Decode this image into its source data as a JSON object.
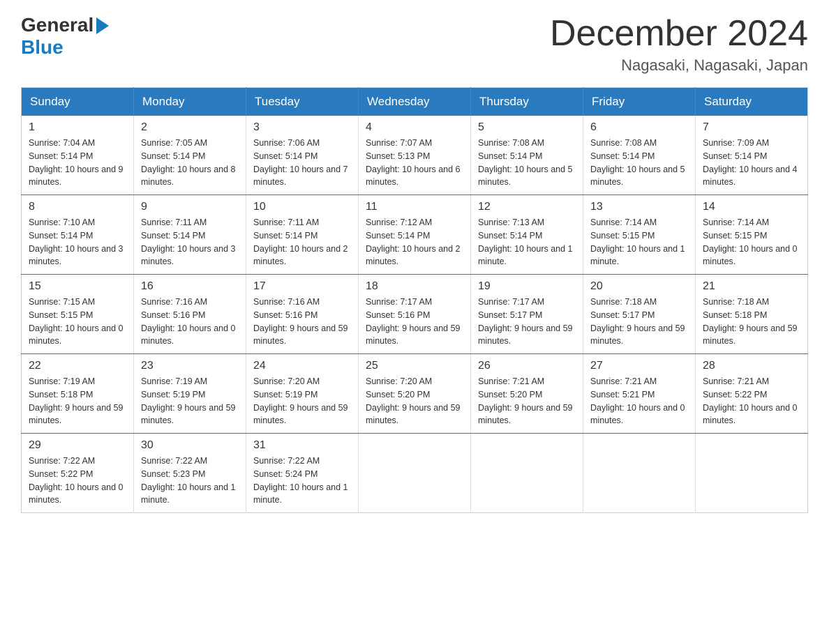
{
  "header": {
    "logo_general": "General",
    "logo_blue": "Blue",
    "title": "December 2024",
    "location": "Nagasaki, Nagasaki, Japan"
  },
  "days_of_week": [
    "Sunday",
    "Monday",
    "Tuesday",
    "Wednesday",
    "Thursday",
    "Friday",
    "Saturday"
  ],
  "weeks": [
    [
      {
        "day": "1",
        "sunrise": "7:04 AM",
        "sunset": "5:14 PM",
        "daylight": "10 hours and 9 minutes."
      },
      {
        "day": "2",
        "sunrise": "7:05 AM",
        "sunset": "5:14 PM",
        "daylight": "10 hours and 8 minutes."
      },
      {
        "day": "3",
        "sunrise": "7:06 AM",
        "sunset": "5:14 PM",
        "daylight": "10 hours and 7 minutes."
      },
      {
        "day": "4",
        "sunrise": "7:07 AM",
        "sunset": "5:13 PM",
        "daylight": "10 hours and 6 minutes."
      },
      {
        "day": "5",
        "sunrise": "7:08 AM",
        "sunset": "5:14 PM",
        "daylight": "10 hours and 5 minutes."
      },
      {
        "day": "6",
        "sunrise": "7:08 AM",
        "sunset": "5:14 PM",
        "daylight": "10 hours and 5 minutes."
      },
      {
        "day": "7",
        "sunrise": "7:09 AM",
        "sunset": "5:14 PM",
        "daylight": "10 hours and 4 minutes."
      }
    ],
    [
      {
        "day": "8",
        "sunrise": "7:10 AM",
        "sunset": "5:14 PM",
        "daylight": "10 hours and 3 minutes."
      },
      {
        "day": "9",
        "sunrise": "7:11 AM",
        "sunset": "5:14 PM",
        "daylight": "10 hours and 3 minutes."
      },
      {
        "day": "10",
        "sunrise": "7:11 AM",
        "sunset": "5:14 PM",
        "daylight": "10 hours and 2 minutes."
      },
      {
        "day": "11",
        "sunrise": "7:12 AM",
        "sunset": "5:14 PM",
        "daylight": "10 hours and 2 minutes."
      },
      {
        "day": "12",
        "sunrise": "7:13 AM",
        "sunset": "5:14 PM",
        "daylight": "10 hours and 1 minute."
      },
      {
        "day": "13",
        "sunrise": "7:14 AM",
        "sunset": "5:15 PM",
        "daylight": "10 hours and 1 minute."
      },
      {
        "day": "14",
        "sunrise": "7:14 AM",
        "sunset": "5:15 PM",
        "daylight": "10 hours and 0 minutes."
      }
    ],
    [
      {
        "day": "15",
        "sunrise": "7:15 AM",
        "sunset": "5:15 PM",
        "daylight": "10 hours and 0 minutes."
      },
      {
        "day": "16",
        "sunrise": "7:16 AM",
        "sunset": "5:16 PM",
        "daylight": "10 hours and 0 minutes."
      },
      {
        "day": "17",
        "sunrise": "7:16 AM",
        "sunset": "5:16 PM",
        "daylight": "9 hours and 59 minutes."
      },
      {
        "day": "18",
        "sunrise": "7:17 AM",
        "sunset": "5:16 PM",
        "daylight": "9 hours and 59 minutes."
      },
      {
        "day": "19",
        "sunrise": "7:17 AM",
        "sunset": "5:17 PM",
        "daylight": "9 hours and 59 minutes."
      },
      {
        "day": "20",
        "sunrise": "7:18 AM",
        "sunset": "5:17 PM",
        "daylight": "9 hours and 59 minutes."
      },
      {
        "day": "21",
        "sunrise": "7:18 AM",
        "sunset": "5:18 PM",
        "daylight": "9 hours and 59 minutes."
      }
    ],
    [
      {
        "day": "22",
        "sunrise": "7:19 AM",
        "sunset": "5:18 PM",
        "daylight": "9 hours and 59 minutes."
      },
      {
        "day": "23",
        "sunrise": "7:19 AM",
        "sunset": "5:19 PM",
        "daylight": "9 hours and 59 minutes."
      },
      {
        "day": "24",
        "sunrise": "7:20 AM",
        "sunset": "5:19 PM",
        "daylight": "9 hours and 59 minutes."
      },
      {
        "day": "25",
        "sunrise": "7:20 AM",
        "sunset": "5:20 PM",
        "daylight": "9 hours and 59 minutes."
      },
      {
        "day": "26",
        "sunrise": "7:21 AM",
        "sunset": "5:20 PM",
        "daylight": "9 hours and 59 minutes."
      },
      {
        "day": "27",
        "sunrise": "7:21 AM",
        "sunset": "5:21 PM",
        "daylight": "10 hours and 0 minutes."
      },
      {
        "day": "28",
        "sunrise": "7:21 AM",
        "sunset": "5:22 PM",
        "daylight": "10 hours and 0 minutes."
      }
    ],
    [
      {
        "day": "29",
        "sunrise": "7:22 AM",
        "sunset": "5:22 PM",
        "daylight": "10 hours and 0 minutes."
      },
      {
        "day": "30",
        "sunrise": "7:22 AM",
        "sunset": "5:23 PM",
        "daylight": "10 hours and 1 minute."
      },
      {
        "day": "31",
        "sunrise": "7:22 AM",
        "sunset": "5:24 PM",
        "daylight": "10 hours and 1 minute."
      },
      null,
      null,
      null,
      null
    ]
  ],
  "labels": {
    "sunrise": "Sunrise:",
    "sunset": "Sunset:",
    "daylight": "Daylight:"
  }
}
